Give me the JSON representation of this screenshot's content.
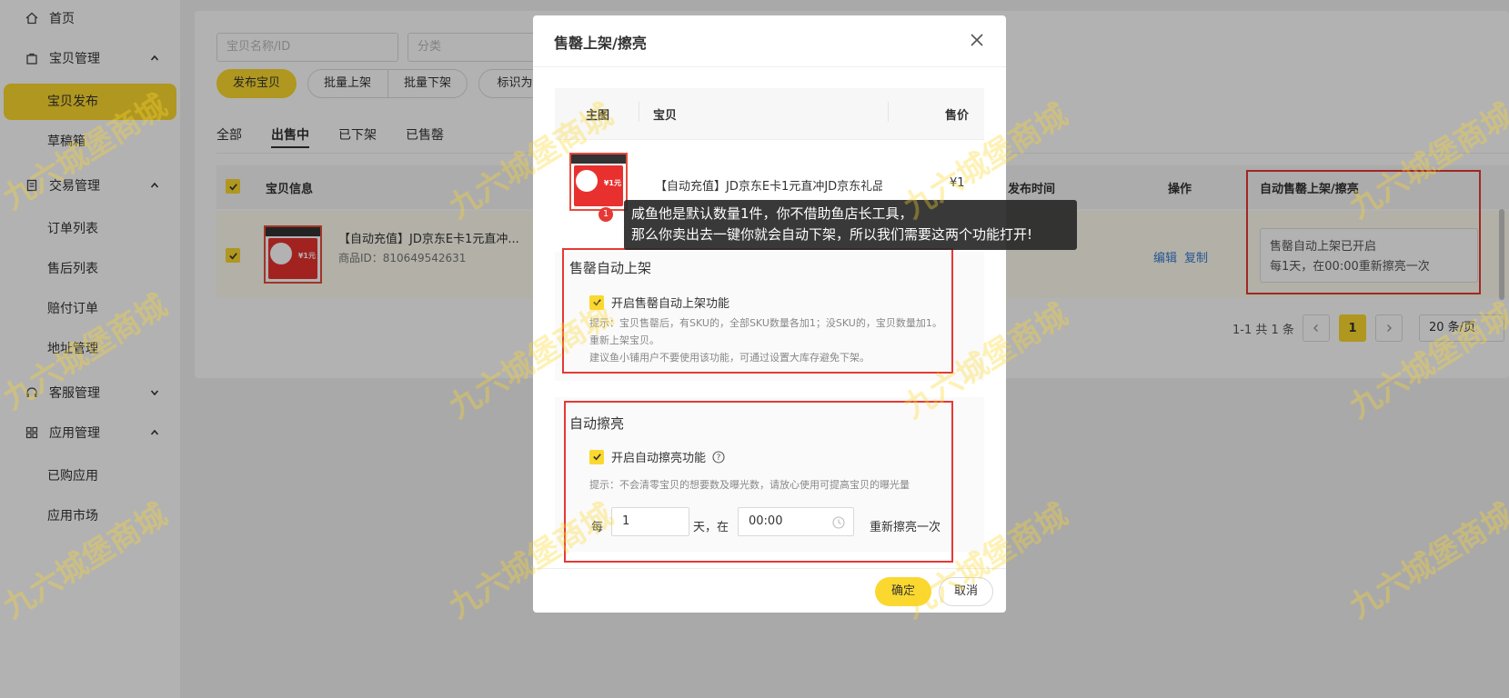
{
  "sidebar": {
    "home": "首页",
    "goods_mgmt": "宝贝管理",
    "goods_items": [
      "宝贝发布",
      "草稿箱"
    ],
    "trade_mgmt": "交易管理",
    "trade_items": [
      "订单列表",
      "售后列表",
      "赔付订单",
      "地址管理"
    ],
    "service_mgmt": "客服管理",
    "app_mgmt": "应用管理",
    "app_items": [
      "已购应用",
      "应用市场"
    ]
  },
  "filters": {
    "name_placeholder": "宝贝名称/ID",
    "category_placeholder": "分类"
  },
  "actions": {
    "publish": "发布宝贝",
    "batch_up": "批量上架",
    "batch_down": "批量下架",
    "mark": "标识为"
  },
  "tabs": [
    "全部",
    "出售中",
    "已下架",
    "已售罄"
  ],
  "table": {
    "headers": {
      "info": "宝贝信息",
      "publish_time": "发布时间",
      "ops": "操作",
      "auto": "自动售罄上架/擦亮"
    },
    "row": {
      "name": "【自动充值】JD京东E卡1元直冲...",
      "product_id": "商品ID：810649542631",
      "edit": "编辑",
      "copy": "复制",
      "status_line1": "售罄自动上架已开启",
      "status_line2": "每1天，在00:00重新擦亮一次"
    }
  },
  "pagination": {
    "summary": "1-1 共 1 条",
    "current": "1",
    "page_size": "20 条/页"
  },
  "modal": {
    "title": "售罄上架/擦亮",
    "table_headers": {
      "image": "主图",
      "item": "宝贝",
      "price": "售价"
    },
    "item_name": "【自动充值】JD京东E卡1元直冲JD京东礼品",
    "item_price": "¥1",
    "sellout": {
      "title": "售罄自动上架",
      "option": "开启售罄自动上架功能",
      "hint1": "提示：宝贝售罄后，有SKU的，全部SKU数量各加1；没SKU的，宝贝数量加1。",
      "hint2": "重新上架宝贝。",
      "hint3": "建议鱼小铺用户不要使用该功能，可通过设置大库存避免下架。"
    },
    "polish": {
      "title": "自动擦亮",
      "option": "开启自动擦亮功能",
      "hint": "提示：不会清零宝贝的想要数及曝光数，请放心使用可提高宝贝的曝光量",
      "every": "每",
      "days_value": "1",
      "days_at": "天，在",
      "time_value": "00:00",
      "suffix": "重新擦亮一次"
    },
    "ok": "确定",
    "cancel": "取消"
  },
  "tooltip": {
    "badge": "1",
    "line1": "咸鱼他是默认数量1件，你不借助鱼店长工具，",
    "line2": "那么你卖出去一键你就会自动下架，所以我们需要这两个功能打开!"
  },
  "thumb": {
    "price": "¥1元"
  },
  "watermark": "九六城堡商城",
  "colors": {
    "accent": "#fbd82f",
    "highlight": "#e53935",
    "link": "#3a7bd5"
  }
}
